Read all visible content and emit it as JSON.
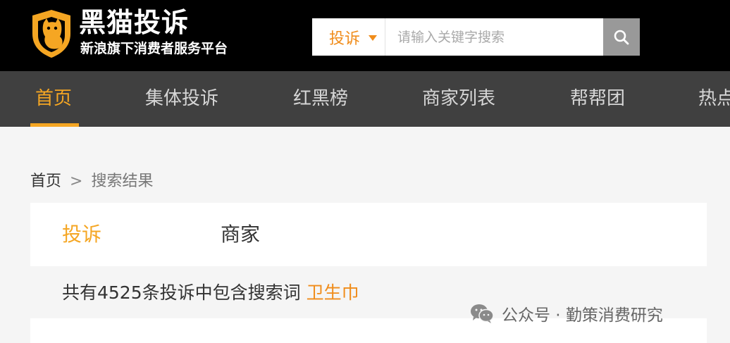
{
  "brand": {
    "title": "黑猫投诉",
    "subtitle": "新浪旗下消费者服务平台",
    "accent": "#f5a623"
  },
  "search": {
    "type_label": "投诉",
    "placeholder": "请输入关键字搜索",
    "value": "",
    "button_icon": "search-icon"
  },
  "nav": {
    "items": [
      {
        "label": "首页",
        "active": true
      },
      {
        "label": "集体投诉",
        "active": false
      },
      {
        "label": "红黑榜",
        "active": false
      },
      {
        "label": "商家列表",
        "active": false
      },
      {
        "label": "帮帮团",
        "active": false
      },
      {
        "label": "热点",
        "active": false
      }
    ]
  },
  "breadcrumb": {
    "home": "首页",
    "separator": ">",
    "current": "搜索结果"
  },
  "tabs": [
    {
      "label": "投诉",
      "active": true
    },
    {
      "label": "商家",
      "active": false
    }
  ],
  "summary": {
    "text": "共有4525条投诉中包含搜索词",
    "keyword": "卫生巾"
  },
  "watermark": {
    "text": "公众号 · 勤策消费研究",
    "icon": "wechat-icon"
  }
}
